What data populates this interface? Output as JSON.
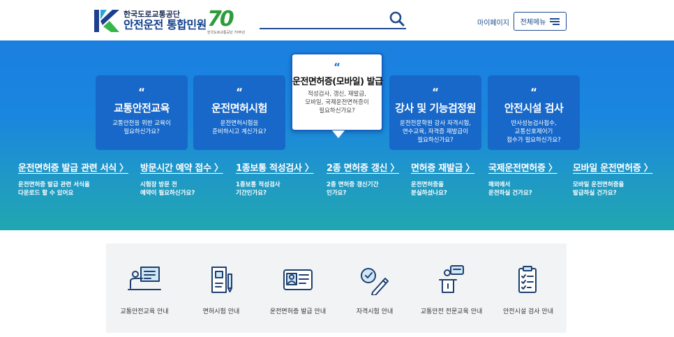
{
  "header": {
    "logo_top": "한국도로교통공단",
    "logo_main": "안전운전 통합민원",
    "badge_number": "70",
    "badge_sub": "한국도로교통공단 70주년",
    "search_placeholder": "",
    "mypage_label": "마이페이지",
    "allmenu_label": "전체메뉴"
  },
  "cards": [
    {
      "quote": "“",
      "title": "교통안전교육",
      "desc": "교통안전을 위한 교육이\n필요하신가요?"
    },
    {
      "quote": "“",
      "title": "운전면허시험",
      "desc": "운전면허시험을\n준비하시고 계신가요?"
    },
    {
      "quote": "“",
      "title": "운전면허증(모바일) 발급",
      "desc": "적성검사, 갱신, 재발급,\n모바일, 국제운전면허증이\n필요하신가요?"
    },
    {
      "quote": "“",
      "title": "강사 및 기능검정원",
      "desc": "운전전문학원 강사 자격시험,\n연수교육, 자격증 재발급이\n필요하신가요?"
    },
    {
      "quote": "“",
      "title": "안전시설 검사",
      "desc": "반사성능검사접수,\n교통신호제어기\n접수가 필요하신가요?"
    }
  ],
  "links": [
    {
      "title": "운전면허증 발급 관련 서식 〉",
      "desc": "운전면허증 발급 관련 서식을\n다운로드 할 수 있어요"
    },
    {
      "title": "방문시간 예약 접수 〉",
      "desc": "시험장 방문 전\n예약이 필요하신가요?"
    },
    {
      "title": "1종보통 적성검사 〉",
      "desc": "1종보통 적성검사\n기간인가요?"
    },
    {
      "title": "2종 면허증 갱신 〉",
      "desc": "2종 면허증 갱신기간\n인가요?"
    },
    {
      "title": "면허증 재발급 〉",
      "desc": "운전면허증을\n분실하셨나요?"
    },
    {
      "title": "국제운전면허증 〉",
      "desc": "해외에서\n운전하실 건가요?"
    },
    {
      "title": "모바일 운전면허증 〉",
      "desc": "모바일 운전면허증을\n발급하실 건가요?"
    }
  ],
  "quick": [
    {
      "label": "교통안전교육 안내",
      "icon": "teacher-board-icon"
    },
    {
      "label": "면허시험 안내",
      "icon": "license-document-icon"
    },
    {
      "label": "운전면허증 발급 안내",
      "icon": "id-card-icon"
    },
    {
      "label": "자격시험 안내",
      "icon": "exam-pencil-icon"
    },
    {
      "label": "교통안전 전문교육 안내",
      "icon": "lecture-podium-icon"
    },
    {
      "label": "안전시설 검사 안내",
      "icon": "checklist-clipboard-icon"
    }
  ],
  "colors": {
    "brand_blue": "#1f4b8f",
    "card_blue": "#1768c9",
    "hero_top": "#1b7fe0",
    "hero_bottom": "#20a7b0",
    "badge_green": "#2e9c3a"
  }
}
